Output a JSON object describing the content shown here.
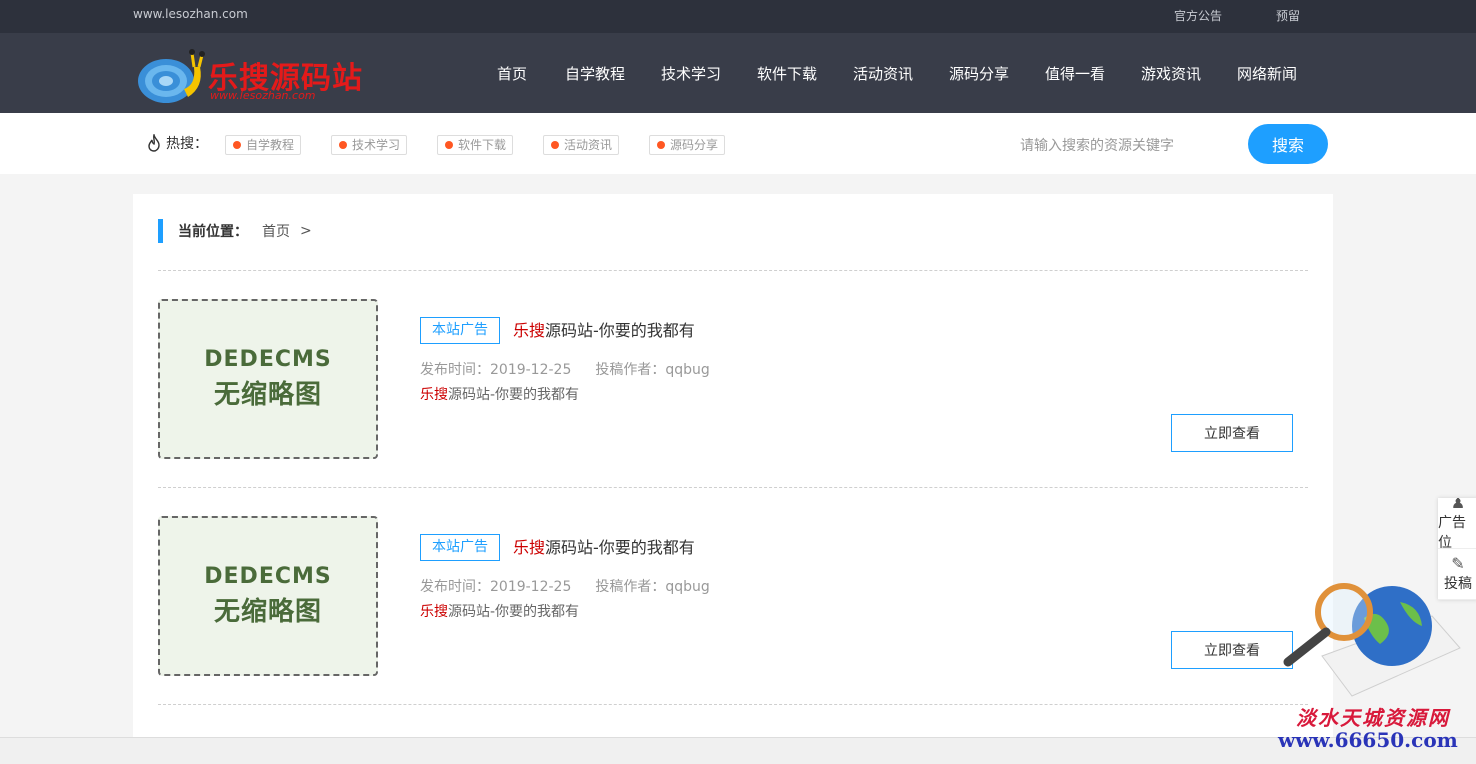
{
  "topbar": {
    "domain": "www.lesozhan.com",
    "links": [
      "官方公告",
      "预留"
    ]
  },
  "logo": {
    "title": "乐搜源码站",
    "subtitle": "www.lesozhan.com"
  },
  "nav": [
    "首页",
    "自学教程",
    "技术学习",
    "软件下载",
    "活动资讯",
    "源码分享",
    "值得一看",
    "游戏资讯",
    "网络新闻"
  ],
  "hot": {
    "label": "热搜：",
    "tags": [
      "自学教程",
      "技术学习",
      "软件下载",
      "活动资讯",
      "源码分享"
    ]
  },
  "search": {
    "placeholder": "请输入搜索的资源关键字",
    "button": "搜索"
  },
  "breadcrumb": {
    "label": "当前位置：",
    "home": "首页",
    "sep": ">"
  },
  "articles": [
    {
      "thumb_line1": "DEDECMS",
      "thumb_line2": "无缩略图",
      "badge": "本站广告",
      "title_hl": "乐搜",
      "title_rest": "源码站-你要的我都有",
      "date": "发布时间：2019-12-25",
      "author": "投稿作者：qqbug",
      "desc_hl": "乐搜",
      "desc_rest": "源码站-你要的我都有",
      "button": "立即查看"
    },
    {
      "thumb_line1": "DEDECMS",
      "thumb_line2": "无缩略图",
      "badge": "本站广告",
      "title_hl": "乐搜",
      "title_rest": "源码站-你要的我都有",
      "date": "发布时间：2019-12-25",
      "author": "投稿作者：qqbug",
      "desc_hl": "乐搜",
      "desc_rest": "源码站-你要的我都有",
      "button": "立即查看"
    }
  ],
  "side_float": [
    {
      "icon": "user-icon",
      "label": "广告位"
    },
    {
      "icon": "edit-icon",
      "label": "投稿"
    }
  ],
  "watermark": {
    "line1": "淡水天城资源网",
    "line2": "www.66650.com"
  },
  "colors": {
    "accent": "#1e9fff",
    "header": "#393d49",
    "topbar": "#2d313c",
    "highlight": "#cc0000",
    "hot_dot": "#ff5722"
  }
}
